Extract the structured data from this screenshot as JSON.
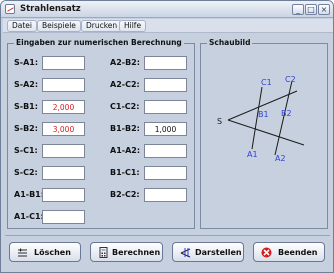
{
  "window": {
    "title": "Strahlensatz"
  },
  "menu": [
    "Datei",
    "Beispiele",
    "Drucken",
    "Hilfe"
  ],
  "inputs": {
    "title": "Eingaben zur numerischen Berechnung",
    "left": [
      {
        "label": "S-A1:",
        "value": ""
      },
      {
        "label": "S-A2:",
        "value": ""
      },
      {
        "label": "S-B1:",
        "value": "2,000"
      },
      {
        "label": "S-B2:",
        "value": "3,000"
      },
      {
        "label": "S-C1:",
        "value": ""
      },
      {
        "label": "S-C2:",
        "value": ""
      },
      {
        "label": "A1-B1:",
        "value": ""
      },
      {
        "label": "A1-C1:",
        "value": ""
      }
    ],
    "right": [
      {
        "label": "A2-B2:",
        "value": ""
      },
      {
        "label": "A2-C2:",
        "value": ""
      },
      {
        "label": "C1-C2:",
        "value": ""
      },
      {
        "label": "B1-B2:",
        "value": "1,000"
      },
      {
        "label": "A1-A2:",
        "value": ""
      },
      {
        "label": "B1-C1:",
        "value": ""
      },
      {
        "label": "B2-C2:",
        "value": ""
      }
    ]
  },
  "schaubild": {
    "title": "Schaubild",
    "labels": {
      "s": "S",
      "a1": "A1",
      "a2": "A2",
      "b1": "B1",
      "b2": "B2",
      "c1": "C1",
      "c2": "C2"
    }
  },
  "buttons": {
    "loeschen": "Löschen",
    "berechnen": "Berechnen",
    "darstellen": "Darstellen",
    "beenden": "Beenden"
  },
  "colors": {
    "value_highlight": "#d21e1e",
    "diagram_blue": "#2f3fd6"
  }
}
